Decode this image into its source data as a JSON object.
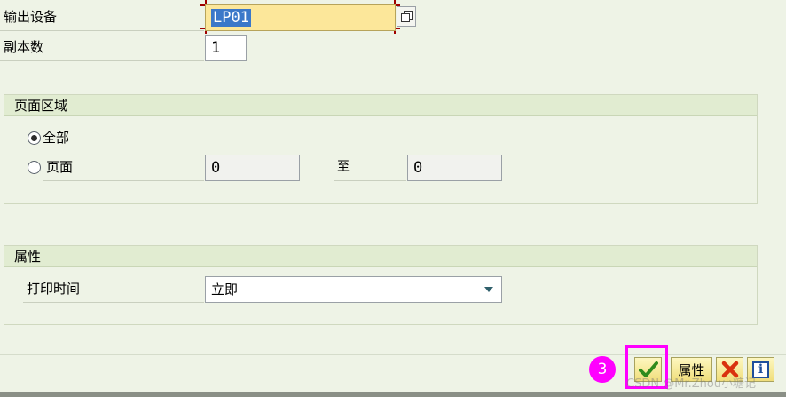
{
  "form": {
    "output_device_label": "输出设备",
    "output_device_value": "LP01",
    "copies_label": "副本数",
    "copies_value": "1"
  },
  "page_area": {
    "title": "页面区域",
    "all_label": "全部",
    "pages_label": "页面",
    "from_value": "0",
    "to_label": "至",
    "to_value": "0",
    "selected": "all"
  },
  "properties": {
    "title": "属性",
    "print_time_label": "打印时间",
    "print_time_value": "立即"
  },
  "toolbar": {
    "step_badge": "3",
    "properties_button_label": "属性"
  },
  "watermark": "CSDN @Mr.Zhou小糖记",
  "colors": {
    "highlight": "#ff00ff",
    "confirm_check": "#2e8b1d",
    "cancel_x": "#d9320e",
    "info": "#1f4f9c",
    "input_focus": "#fce79a"
  }
}
